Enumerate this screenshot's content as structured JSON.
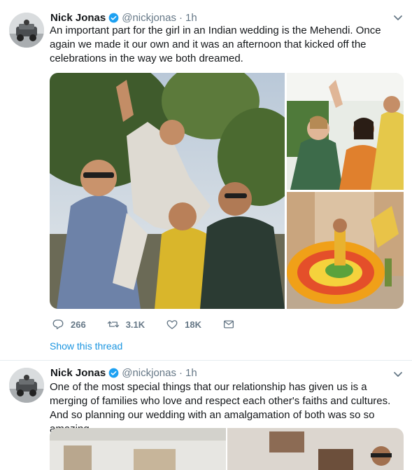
{
  "tweets": [
    {
      "author": "Nick Jonas",
      "handle": "@nickjonas",
      "separator": "·",
      "time": "1h",
      "text": "An important part for the girl in an Indian wedding is the Mehendi. Once again we made it our own and it was an afternoon that kicked off the celebrations in the way we both dreamed.",
      "replies": "266",
      "retweets": "3.1K",
      "likes": "18K",
      "thread_link": "Show this thread"
    },
    {
      "author": "Nick Jonas",
      "handle": "@nickjonas",
      "separator": "·",
      "time": "1h",
      "text": "One of the most special things that our relationship has given us is a merging of families who love and respect each other's faiths and cultures. And so planning our wedding with an amalgamation of both was so so amazing."
    }
  ],
  "colors": {
    "link": "#1b95e0",
    "verified": "#1da1f2",
    "muted": "#657786"
  },
  "icons": [
    "reply-icon",
    "retweet-icon",
    "like-icon",
    "message-icon",
    "verified-badge-icon",
    "chevron-down-icon"
  ]
}
